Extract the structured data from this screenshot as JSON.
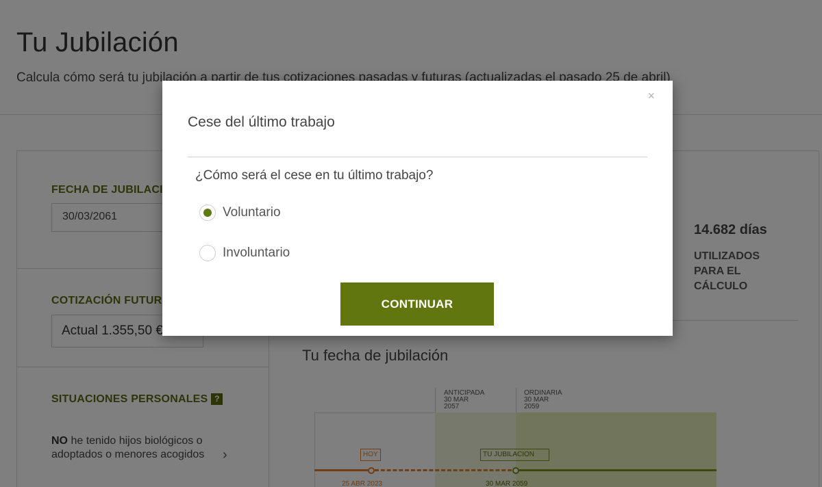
{
  "page": {
    "title": "Tu Jubilación",
    "subtitle": "Calcula cómo será tu jubilación a partir de tus cotizaciones pasadas y futuras (actualizadas el pasado 25 de abril)"
  },
  "left_panel": {
    "fecha_label": "FECHA DE JUBILACIÓN",
    "fecha_value": "30/03/2061",
    "cotizacion_label": "COTIZACIÓN FUTURA",
    "cotizacion_value": "Actual 1.355,50 €",
    "situaciones_label": "SITUACIONES PERSONALES",
    "situaciones_help": "?",
    "situaciones_bold": "NO",
    "situaciones_text": " he tenido hijos biológicos o adoptados o menores acogidos",
    "chevron": "›"
  },
  "right_panel": {
    "days_value": "14.682 días",
    "days_label": "UTILIZADOS PARA EL CÁLCULO",
    "timeline_title": "Tu fecha de jubilación",
    "timeline": {
      "anticipada_label": "ANTICIPADA",
      "anticipada_date": "30 MAR 2057",
      "ordinaria_label": "ORDINARIA",
      "ordinaria_date": "30 MAR 2059",
      "hoy_label": "HOY",
      "hoy_date": "25 ABR 2023",
      "tu_jubilacion_label": "TU JUBILACION",
      "tu_jubilacion_date": "30 MAR 2059"
    }
  },
  "modal": {
    "close_icon": "×",
    "title": "Cese del último trabajo",
    "question": "¿Cómo será el cese en tu último trabajo?",
    "options": [
      {
        "label": "Voluntario",
        "selected": true
      },
      {
        "label": "Involuntario",
        "selected": false
      }
    ],
    "continue_label": "CONTINUAR"
  },
  "colors": {
    "brand_green": "#627610",
    "orange": "#e07a2a",
    "overlay": "rgba(0,0,0,0.5)"
  }
}
